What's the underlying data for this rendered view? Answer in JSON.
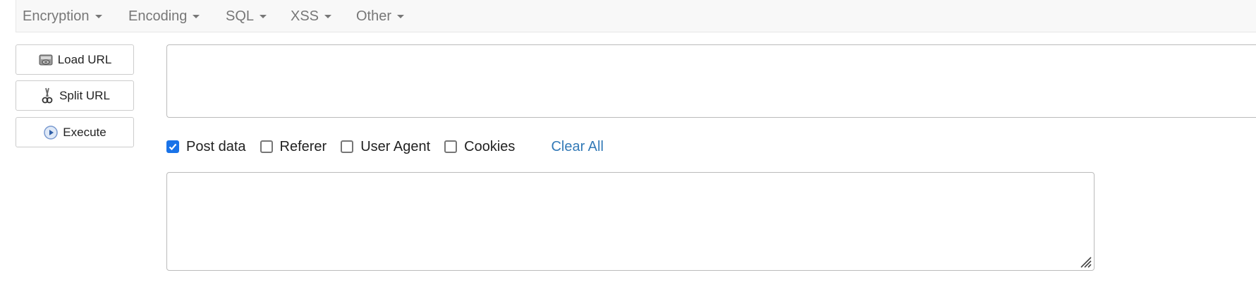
{
  "menu": {
    "items": [
      {
        "label": "Encryption"
      },
      {
        "label": "Encoding"
      },
      {
        "label": "SQL"
      },
      {
        "label": "XSS"
      },
      {
        "label": "Other"
      }
    ]
  },
  "sidebar": {
    "load_url": {
      "label": "Load URL",
      "icon": "load-url-icon"
    },
    "split_url": {
      "label": "Split URL",
      "icon": "scissors-icon"
    },
    "execute": {
      "label": "Execute",
      "icon": "play-icon"
    }
  },
  "url_input": {
    "value": ""
  },
  "options": {
    "post_data": {
      "label": "Post data",
      "checked": true
    },
    "referer": {
      "label": "Referer",
      "checked": false
    },
    "user_agent": {
      "label": "User Agent",
      "checked": false
    },
    "cookies": {
      "label": "Cookies",
      "checked": false
    },
    "clear_all": "Clear All"
  },
  "post_input": {
    "value": ""
  },
  "colors": {
    "link": "#337ab7",
    "checkbox_checked": "#1a73e8",
    "menu_text": "#777777"
  }
}
